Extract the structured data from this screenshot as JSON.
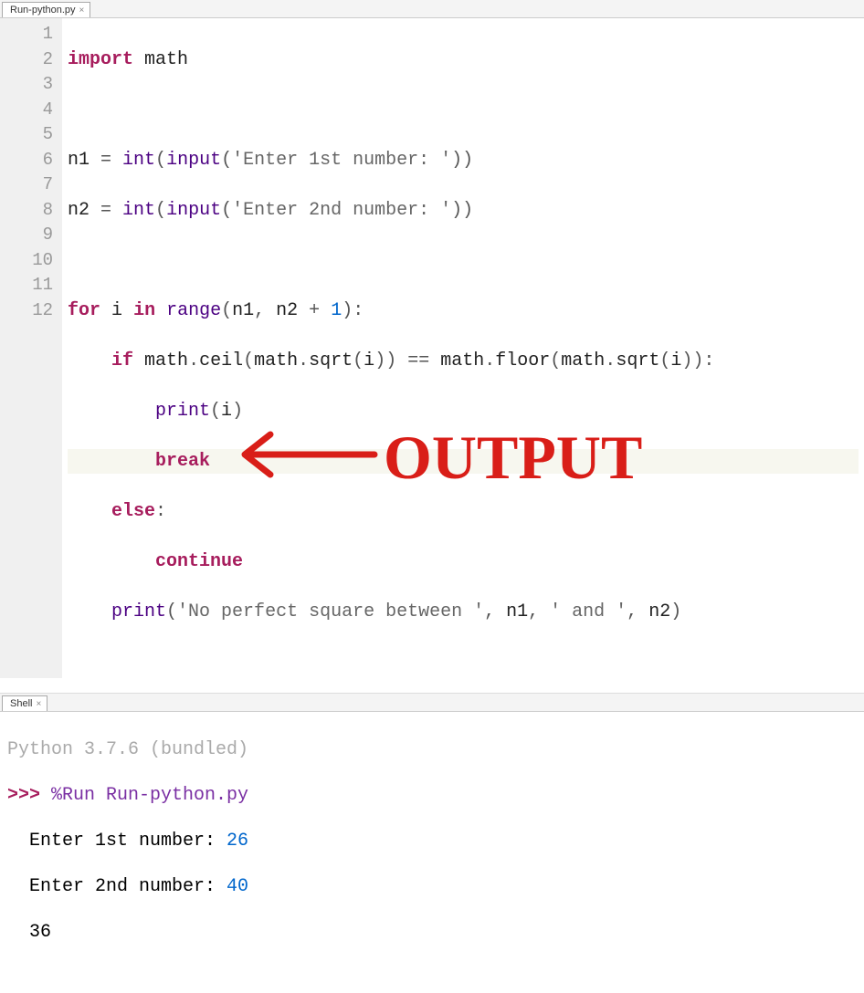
{
  "editor_tab": {
    "label": "Run-python.py"
  },
  "code": {
    "lines": [
      "1",
      "2",
      "3",
      "4",
      "5",
      "6",
      "7",
      "8",
      "9",
      "10",
      "11",
      "12"
    ],
    "l1": {
      "kw": "import",
      "mod": "math"
    },
    "l3": {
      "v": "n1",
      "eq": " = ",
      "fn1": "int",
      "fn2": "input",
      "s": "'Enter 1st number: '"
    },
    "l4": {
      "v": "n2",
      "eq": " = ",
      "fn1": "int",
      "fn2": "input",
      "s": "'Enter 2nd number: '"
    },
    "l6": {
      "for": "for",
      "i": "i",
      "in": "in",
      "rng": "range",
      "a": "n1",
      "b": "n2",
      "plus": " + ",
      "one": "1"
    },
    "l7": {
      "if": "if",
      "m": "math",
      "ceil": "ceil",
      "sqrt": "sqrt",
      "i": "i",
      "eq": " == ",
      "floor": "floor"
    },
    "l8": {
      "pr": "print",
      "i": "i"
    },
    "l9": {
      "br": "break"
    },
    "l10": {
      "el": "else"
    },
    "l11": {
      "ct": "continue"
    },
    "l12": {
      "pr": "print",
      "s1": "'No perfect square between '",
      "n1": "n1",
      "s2": "' and '",
      "n2": "n2"
    }
  },
  "shell_tab": {
    "label": "Shell"
  },
  "shell": {
    "banner": "Python 3.7.6 (bundled)",
    "prompt": ">>> ",
    "cmd": "%Run Run-python.py",
    "p1": "  Enter 1st number: ",
    "v1": "26",
    "p2": "  Enter 2nd number: ",
    "v2": "40",
    "out": "  36"
  },
  "annotation": {
    "text": "OUTPUT"
  }
}
